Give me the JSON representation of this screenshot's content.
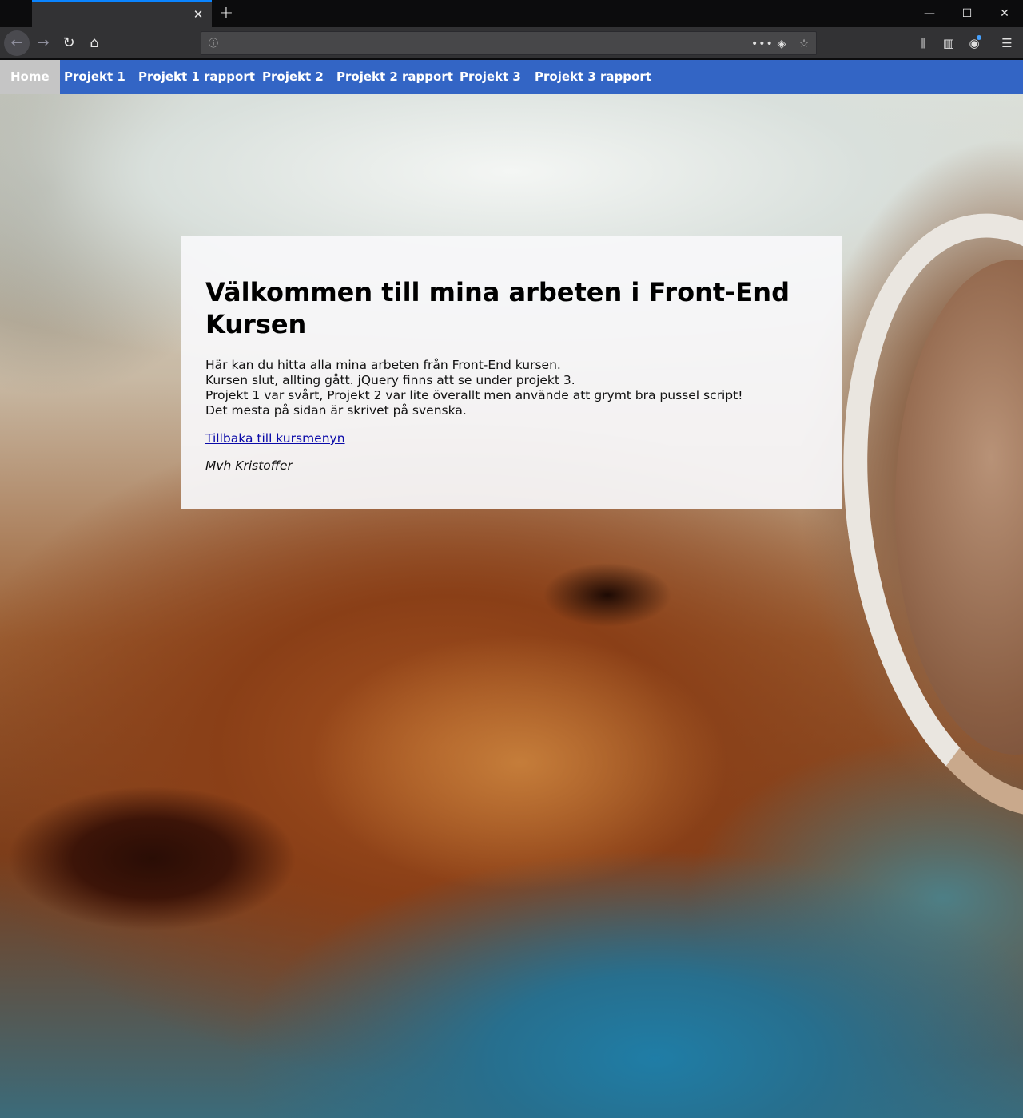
{
  "browser": {
    "tab": {
      "close_glyph": "✕"
    },
    "newtab_glyph": "+",
    "window": {
      "minimize": "—",
      "maximize": "☐",
      "close": "✕"
    },
    "toolbar": {
      "back": "←",
      "forward": "→",
      "reload": "↻",
      "home": "⌂",
      "info": "ⓘ",
      "more": "•••",
      "pocket": "◈",
      "star": "☆",
      "library": "⫼",
      "sidebar": "▥",
      "account": "◉",
      "menu": "☰"
    },
    "url": ""
  },
  "site": {
    "nav": [
      {
        "label": "Home",
        "active": true
      },
      {
        "label": "Projekt 1"
      },
      {
        "label": "Projekt 1 rapport"
      },
      {
        "label": "Projekt 2"
      },
      {
        "label": "Projekt 2 rapport"
      },
      {
        "label": "Projekt 3"
      },
      {
        "label": "Projekt 3 rapport"
      }
    ],
    "nav_active_color": "#c5c5c5",
    "nav_color": "#3365c5",
    "heading": "Välkommen till mina arbeten i Front-End Kursen",
    "lines": [
      "Här kan du hitta alla mina arbeten från Front-End kursen.",
      "Kursen slut, allting gått. jQuery finns att se under projekt 3.",
      "Projekt 1 var svårt, Projekt 2 var lite överallt men använde att grymt bra pussel script!",
      "Det mesta på sidan är skrivet på svenska."
    ],
    "back_link": "Tillbaka till kursmenyn",
    "signature": "Mvh Kristoffer"
  }
}
